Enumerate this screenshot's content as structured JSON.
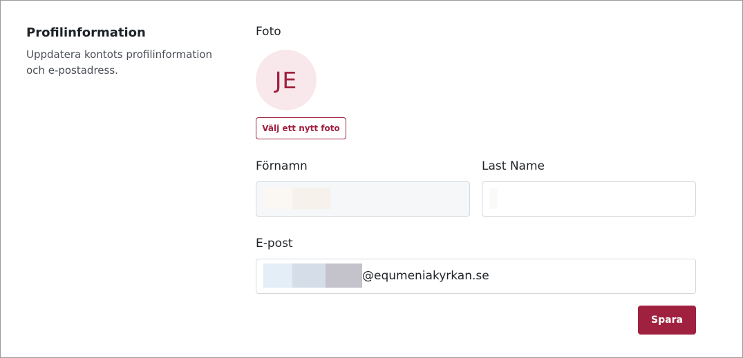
{
  "section": {
    "title": "Profilinformation",
    "description": "Uppdatera kontots profilinformation och e-postadress."
  },
  "photo": {
    "label": "Foto",
    "initials": "JE",
    "select_button": "Välj ett nytt foto"
  },
  "first_name": {
    "label": "Förnamn",
    "value": ""
  },
  "last_name": {
    "label": "Last Name",
    "value": ""
  },
  "email": {
    "label": "E-post",
    "visible_suffix": "@equmeniakyrkan.se"
  },
  "actions": {
    "save_label": "Spara"
  },
  "colors": {
    "accent": "#a0213f",
    "avatar_bg": "#f8e8ec",
    "input_border": "#d4d7dc",
    "disabled_input_bg": "#f6f7f9"
  }
}
